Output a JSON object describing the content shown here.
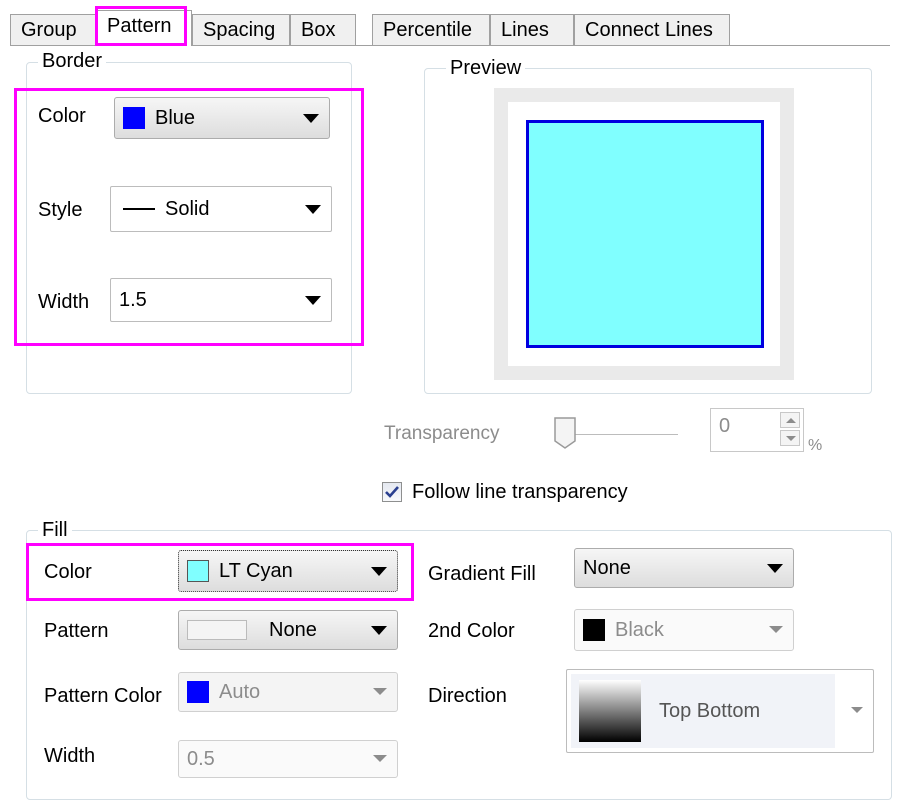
{
  "tabs": [
    {
      "label": "Group"
    },
    {
      "label": "Pattern"
    },
    {
      "label": "Spacing"
    },
    {
      "label": "Box"
    },
    {
      "label": "Percentile"
    },
    {
      "label": "Lines"
    },
    {
      "label": "Connect Lines"
    }
  ],
  "active_tab": "Pattern",
  "border": {
    "title": "Border",
    "color_label": "Color",
    "color_value": "Blue",
    "color_swatch": "#0000ff",
    "style_label": "Style",
    "style_value": "Solid",
    "width_label": "Width",
    "width_value": "1.5"
  },
  "preview": {
    "title": "Preview",
    "fill_color": "#80ffff",
    "border_color": "#0000e0"
  },
  "transparency": {
    "label": "Transparency",
    "value": "0",
    "unit": "%",
    "level": 0
  },
  "follow_line": {
    "label": "Follow line transparency",
    "checked": true
  },
  "fill": {
    "title": "Fill",
    "color_label": "Color",
    "color_value": "LT Cyan",
    "color_swatch": "#80ffff",
    "pattern_label": "Pattern",
    "pattern_value": "None",
    "pattern_color_label": "Pattern Color",
    "pattern_color_value": "Auto",
    "pattern_color_swatch": "#0000ff",
    "width_label": "Width",
    "width_value": "0.5",
    "gradient_label": "Gradient Fill",
    "gradient_value": "None",
    "second_color_label": "2nd Color",
    "second_color_value": "Black",
    "second_color_swatch": "#000000",
    "direction_label": "Direction",
    "direction_value": "Top Bottom"
  },
  "highlight_color": "#ff00ff"
}
